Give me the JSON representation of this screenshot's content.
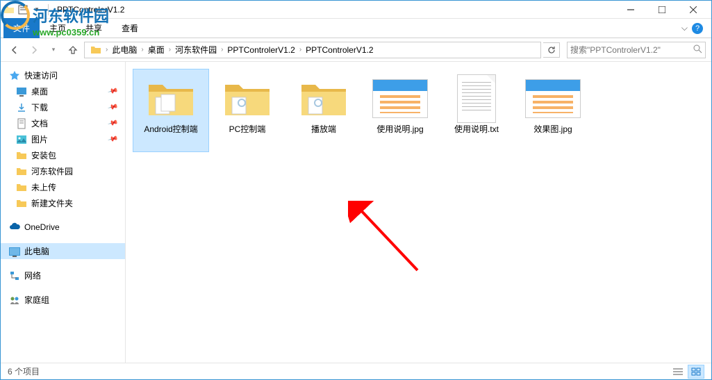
{
  "title": "PPTControlerV1.2",
  "watermark": {
    "text": "河东软件园",
    "url": "www.pc0359.cn"
  },
  "ribbon": {
    "file": "文件",
    "tabs": [
      "主页",
      "共享",
      "查看"
    ]
  },
  "breadcrumb": {
    "items": [
      "此电脑",
      "桌面",
      "河东软件园",
      "PPTControlerV1.2",
      "PPTControlerV1.2"
    ]
  },
  "search": {
    "placeholder": "搜索\"PPTControlerV1.2\""
  },
  "sidebar": {
    "quickaccess": "快速访问",
    "items1": [
      {
        "label": "桌面",
        "pinned": true
      },
      {
        "label": "下载",
        "pinned": true
      },
      {
        "label": "文档",
        "pinned": true
      },
      {
        "label": "图片",
        "pinned": true
      },
      {
        "label": "安装包",
        "pinned": false
      },
      {
        "label": "河东软件园",
        "pinned": false
      },
      {
        "label": "未上传",
        "pinned": false
      },
      {
        "label": "新建文件夹",
        "pinned": false
      }
    ],
    "onedrive": "OneDrive",
    "thispc": "此电脑",
    "network": "网络",
    "homegroup": "家庭组"
  },
  "files": [
    {
      "name": "Android控制端",
      "type": "folder"
    },
    {
      "name": "PC控制端",
      "type": "folder"
    },
    {
      "name": "播放端",
      "type": "folder"
    },
    {
      "name": "使用说明.jpg",
      "type": "image"
    },
    {
      "name": "使用说明.txt",
      "type": "text"
    },
    {
      "name": "效果图.jpg",
      "type": "image"
    }
  ],
  "status": {
    "count": "6 个项目"
  }
}
